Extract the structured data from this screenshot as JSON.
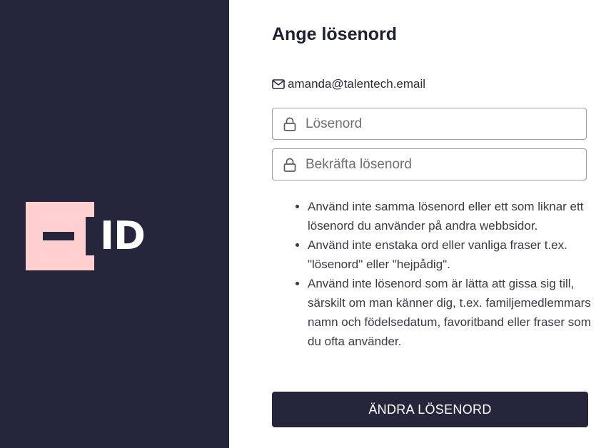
{
  "brand": {
    "logo_text": "ID",
    "colors": {
      "panel": "#25253c",
      "logo_square": "#ffd0cf"
    }
  },
  "form": {
    "title": "Ange lösenord",
    "email_icon": "envelope-icon",
    "email": "amanda@talentech.email",
    "password_field": {
      "icon": "lock-icon",
      "placeholder": "Lösenord",
      "value": ""
    },
    "confirm_field": {
      "icon": "lock-icon",
      "placeholder": "Bekräfta lösenord",
      "value": ""
    },
    "rules": [
      "Använd inte samma lösenord eller ett som liknar ett lösenord du använder på andra webbsidor.",
      "Använd inte enstaka ord eller vanliga fraser t.ex. \"lösenord\" eller \"hejpådig\".",
      "Använd inte lösenord som är lätta att gissa sig till, särskilt om man känner dig, t.ex. familjemedlemmars namn och födelsedatum, favoritband eller fraser som du ofta använder."
    ],
    "submit_label": "ÄNDRA LÖSENORD"
  }
}
